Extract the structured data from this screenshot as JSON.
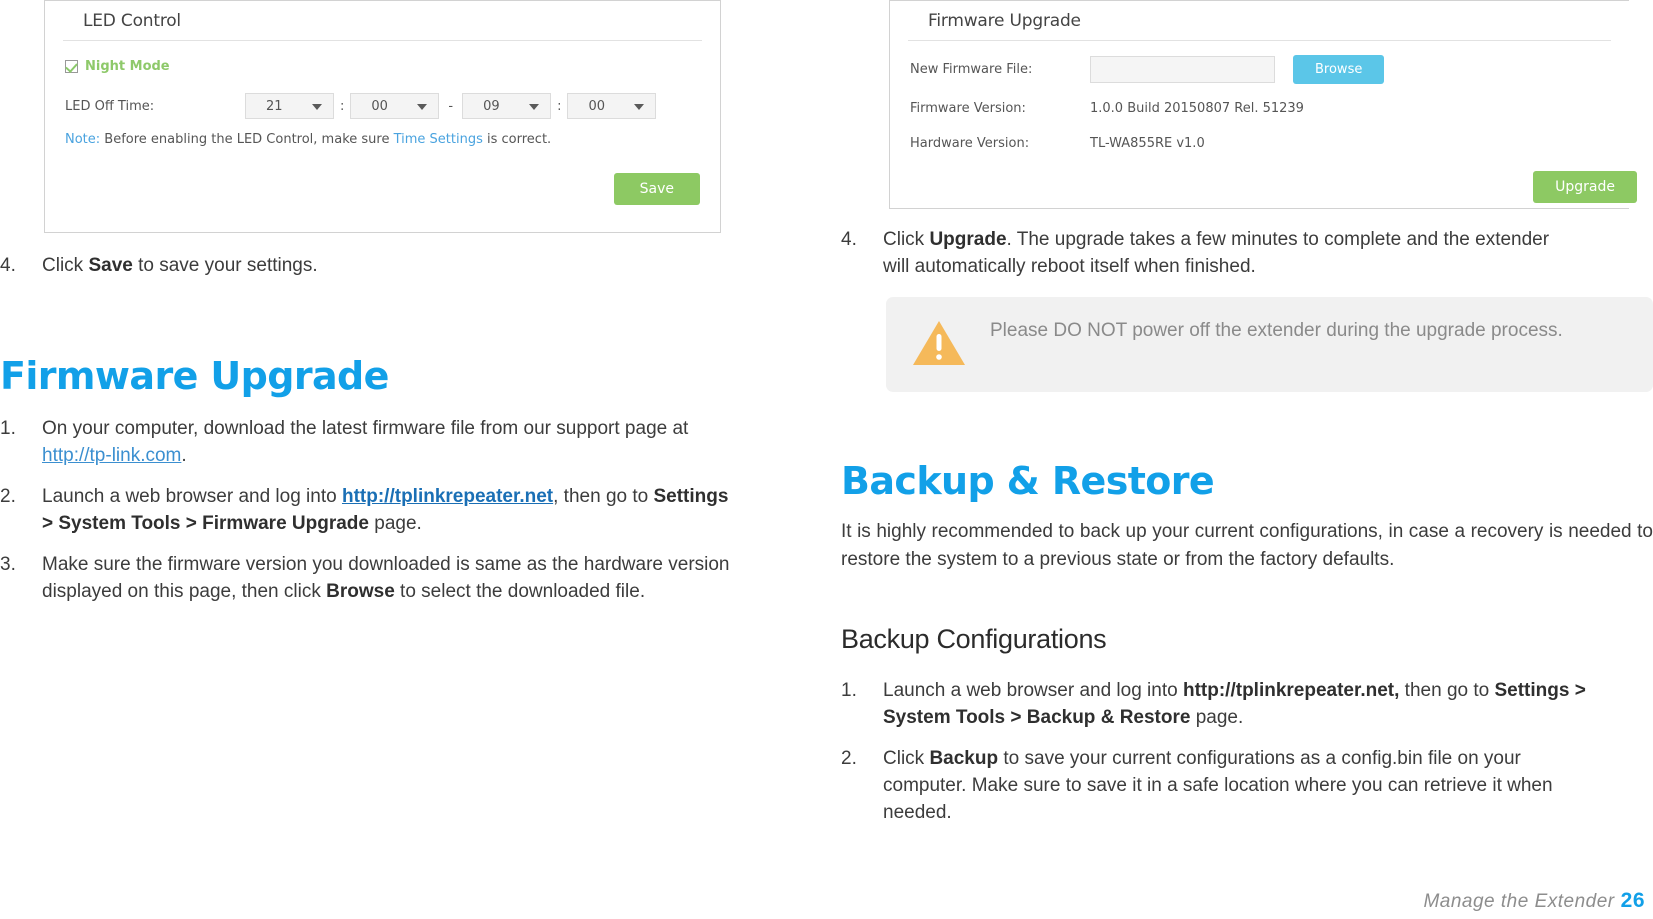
{
  "led_panel": {
    "title": "LED Control",
    "night_mode_label": "Night Mode",
    "night_mode_checked": true,
    "led_off_time_label": "LED Off Time:",
    "start_hour": "21",
    "start_minute": "00",
    "range_dash": "-",
    "end_hour": "09",
    "end_minute": "00",
    "colon": ":",
    "note_key": "Note:",
    "note_before": "Before enabling the LED Control, make sure",
    "note_link": "Time Settings",
    "note_after": "is correct.",
    "save_label": "Save"
  },
  "firmware_panel": {
    "title": "Firmware Upgrade",
    "new_file_label": "New Firmware File:",
    "new_file_value": "",
    "browse_label": "Browse",
    "firmware_version_label": "Firmware Version:",
    "firmware_version_value": "1.0.0 Build 20150807 Rel. 51239",
    "hardware_version_label": "Hardware Version:",
    "hardware_version_value": "TL-WA855RE v1.0",
    "upgrade_label": "Upgrade"
  },
  "left_column": {
    "step4": {
      "num": "4.",
      "pre": "Click ",
      "bold": "Save",
      "post": " to save your settings."
    },
    "heading": "Firmware Upgrade",
    "steps": [
      {
        "num": "1.",
        "part1": "On your computer, download the latest firmware file from our support page at ",
        "link": "http://tp-link.com",
        "part2": "."
      },
      {
        "num": "2.",
        "part1": "Launch a web browser and log into ",
        "link": "http://tplinkrepeater.net",
        "part2": ", then go to ",
        "bold": "Settings > System Tools > Firmware Upgrade",
        "part3": " page."
      },
      {
        "num": "3.",
        "part1": "Make sure the firmware version you downloaded is same as the hardware version displayed on this page, then click ",
        "bold": "Browse",
        "part2": " to select the downloaded file."
      }
    ]
  },
  "right_column": {
    "step4": {
      "num": "4.",
      "pre": "Click ",
      "bold": "Upgrade",
      "post": ". The upgrade takes a few minutes to complete and the extender will automatically reboot itself when finished."
    },
    "warning": {
      "icon": "warning-triangle-icon",
      "text": "Please DO NOT power off the extender during the upgrade process."
    },
    "heading": "Backup & Restore",
    "intro": "It is highly recommended to back up your current configurations, in case a recovery is needed to restore the system to a previous state or from the factory defaults.",
    "subheading": "Backup Configurations",
    "steps": [
      {
        "num": "1.",
        "part1": "Launch a web browser and log into ",
        "bold1": "http://tplinkrepeater.net,",
        "part2": " then go to ",
        "bold2": "Settings > System Tools > Backup & Restore",
        "part3": " page."
      },
      {
        "num": "2.",
        "part1": "Click ",
        "bold1": "Backup",
        "part2": " to save your current configurations as a config.bin file on your computer. Make sure to save it in a safe location where you can retrieve it when needed."
      }
    ]
  },
  "footer": {
    "text": "Manage  the  Extender",
    "page": "26"
  },
  "colors": {
    "accent_blue": "#12a0e8",
    "link_blue": "#3b8fd0",
    "green_button": "#8dc963",
    "blue_button": "#5bc6e8",
    "warning_orange": "#f5b košice"
  }
}
